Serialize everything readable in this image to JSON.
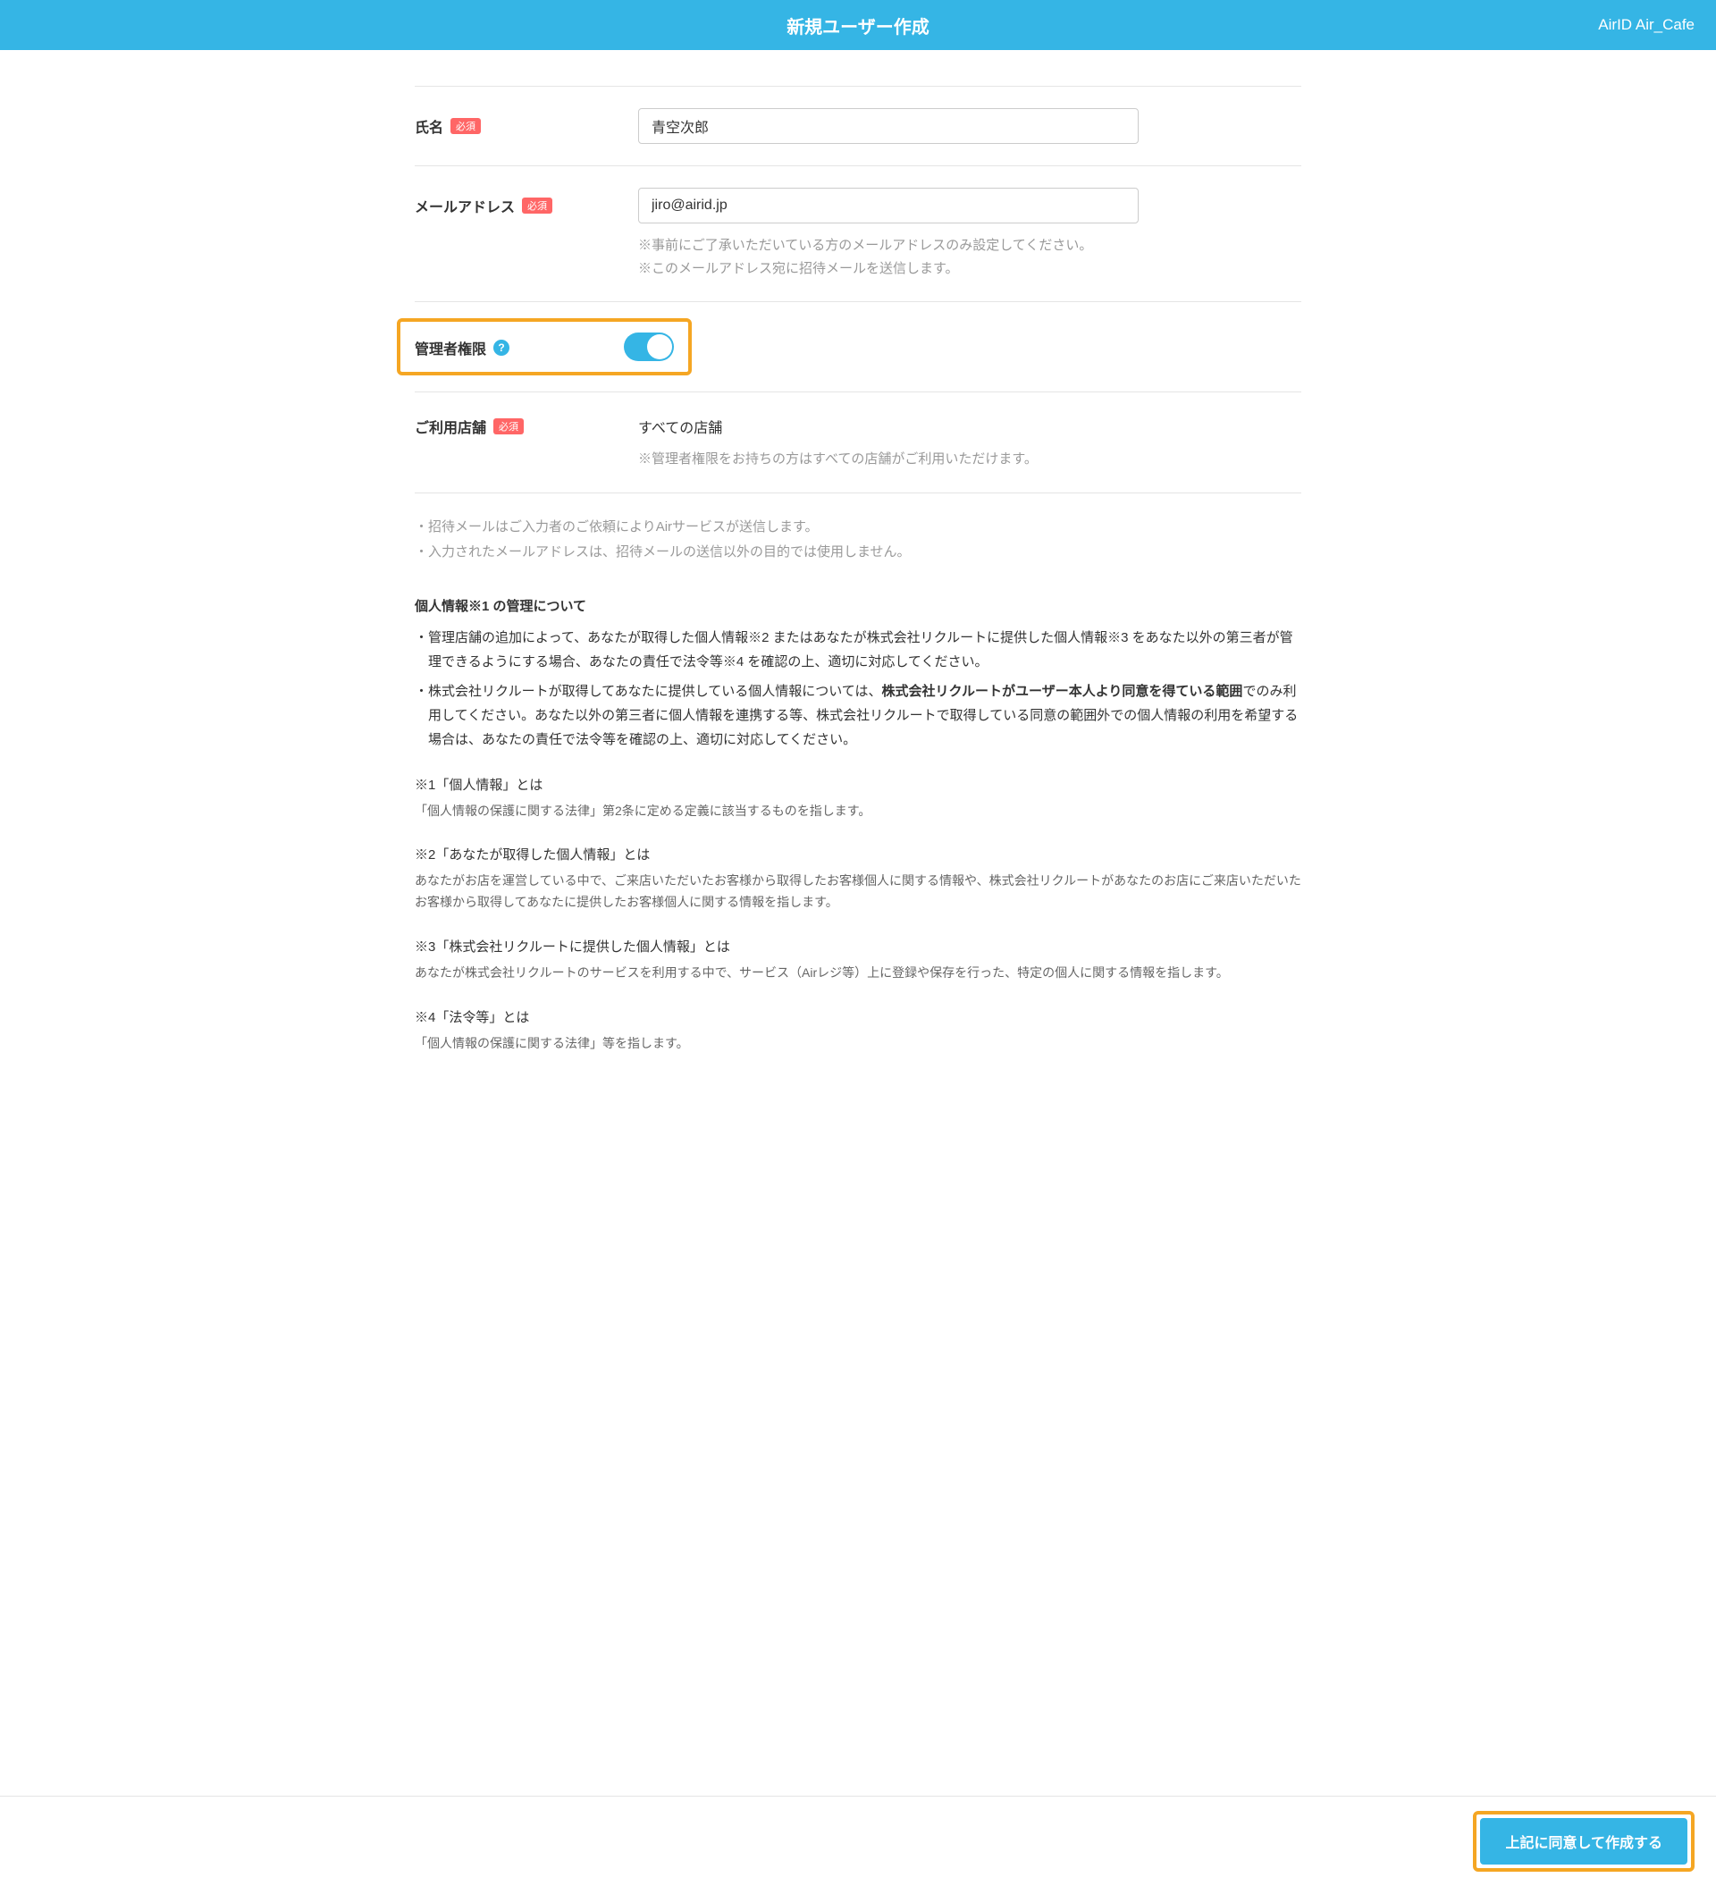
{
  "header": {
    "title": "新規ユーザー作成",
    "account": "AirID Air_Cafe"
  },
  "badges": {
    "required": "必須"
  },
  "form": {
    "name": {
      "label": "氏名",
      "value": "青空次郎"
    },
    "email": {
      "label": "メールアドレス",
      "value": "jiro@airid.jp",
      "hint1": "※事前にご了承いただいている方のメールアドレスのみ設定してください。",
      "hint2": "※このメールアドレス宛に招待メールを送信します。"
    },
    "admin": {
      "label": "管理者権限",
      "enabled": true
    },
    "stores": {
      "label": "ご利用店舗",
      "value": "すべての店舗",
      "hint": "※管理者権限をお持ちの方はすべての店舗がご利用いただけます。"
    }
  },
  "notes": {
    "line1": "・招待メールはご入力者のご依頼によりAirサービスが送信します。",
    "line2": "・入力されたメールアドレスは、招待メールの送信以外の目的では使用しません。"
  },
  "policy": {
    "title": "個人情報※1 の管理について",
    "item1": "管理店舗の追加によって、あなたが取得した個人情報※2 またはあなたが株式会社リクルートに提供した個人情報※3 をあなた以外の第三者が管理できるようにする場合、あなたの責任で法令等※4 を確認の上、適切に対応してください。",
    "item2_pre": "株式会社リクルートが取得してあなたに提供している個人情報については、",
    "item2_bold": "株式会社リクルートがユーザー本人より同意を得ている範囲",
    "item2_post": "でのみ利用してください。あなた以外の第三者に個人情報を連携する等、株式会社リクルートで取得している同意の範囲外での個人情報の利用を希望する場合は、あなたの責任で法令等を確認の上、適切に対応してください。"
  },
  "defs": {
    "d1_title": "※1「個人情報」とは",
    "d1_body": "「個人情報の保護に関する法律」第2条に定める定義に該当するものを指します。",
    "d2_title": "※2「あなたが取得した個人情報」とは",
    "d2_body": "あなたがお店を運営している中で、ご来店いただいたお客様から取得したお客様個人に関する情報や、株式会社リクルートがあなたのお店にご来店いただいたお客様から取得してあなたに提供したお客様個人に関する情報を指します。",
    "d3_title": "※3「株式会社リクルートに提供した個人情報」とは",
    "d3_body": "あなたが株式会社リクルートのサービスを利用する中で、サービス（Airレジ等）上に登録や保存を行った、特定の個人に関する情報を指します。",
    "d4_title": "※4「法令等」とは",
    "d4_body": "「個人情報の保護に関する法律」等を指します。"
  },
  "footer": {
    "submit": "上記に同意して作成する"
  }
}
